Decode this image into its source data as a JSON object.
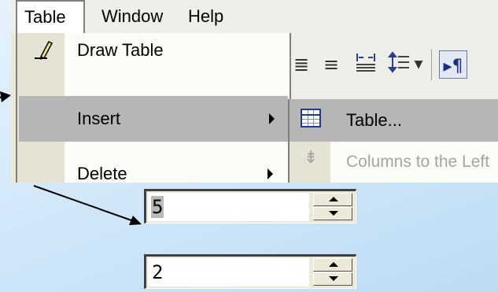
{
  "menubar": {
    "items": [
      {
        "label": "Table"
      },
      {
        "label": "Window"
      },
      {
        "label": "Help"
      }
    ]
  },
  "table_menu": {
    "items": [
      {
        "label": "Draw Table",
        "icon": "pencil-icon"
      },
      {
        "label": "Insert",
        "has_submenu": true,
        "highlighted": true
      },
      {
        "label": "Delete",
        "has_submenu": true
      }
    ]
  },
  "insert_submenu": {
    "items": [
      {
        "label": "Table...",
        "icon": "table-grid-icon",
        "highlighted": true
      },
      {
        "label": "Columns to the Left",
        "icon": "insert-columns-icon",
        "disabled": true
      }
    ]
  },
  "toolbar": {
    "icons": [
      "align-right-icon",
      "justify-icon",
      "distributed-icon",
      "line-spacing-icon",
      "dropdown-arrow-icon",
      "show-hide-formatting-icon"
    ]
  },
  "dialog_fields": {
    "columns": {
      "value": "5"
    },
    "rows": {
      "value": "2"
    }
  },
  "colors": {
    "menu_highlight": "#b6b6b6",
    "menu_gutter": "#e6e3d4",
    "background": "#cfe6f8",
    "disabled_text": "#a4a4a4"
  }
}
